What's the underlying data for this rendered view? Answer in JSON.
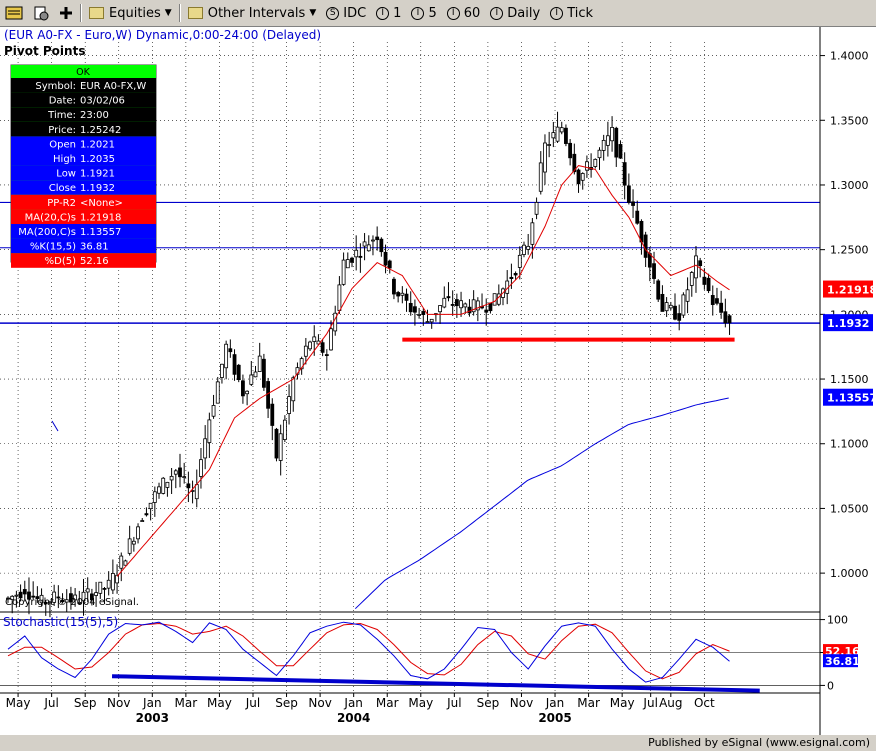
{
  "toolbar": {
    "items": [
      {
        "label": "Equities",
        "icon": "folder-icon",
        "dropdown": true
      },
      {
        "label": "Other Intervals",
        "icon": "folder-icon",
        "dropdown": true
      },
      {
        "label": "IDC",
        "icon": "S"
      },
      {
        "label": "1",
        "icon": "I"
      },
      {
        "label": "5",
        "icon": "I"
      },
      {
        "label": "60",
        "icon": "I"
      },
      {
        "label": "Daily",
        "icon": "I"
      },
      {
        "label": "Tick",
        "icon": "I"
      }
    ]
  },
  "chart": {
    "title": "(EUR A0-FX - Euro,W) Dynamic,0:00-24:00 (Delayed)",
    "study_label": "Pivot Points",
    "copyright": "Copyright © 2004 eSignal.",
    "stochastic_label": "Stochastic(15(5),5)"
  },
  "data_box": {
    "ok_label": "OK",
    "rows": [
      {
        "label": "Symbol:",
        "value": "EUR A0-FX,W",
        "bg": "#000000"
      },
      {
        "label": "Date:",
        "value": "03/02/06",
        "bg": "#000000"
      },
      {
        "label": "Time:",
        "value": "23:00",
        "bg": "#000000"
      },
      {
        "label": "Price:",
        "value": "1.25242",
        "bg": "#000000"
      },
      {
        "label": "Open",
        "value": "1.2021",
        "bg": "#0000ff"
      },
      {
        "label": "High",
        "value": "1.2035",
        "bg": "#0000ff"
      },
      {
        "label": "Low",
        "value": "1.1921",
        "bg": "#0000ff"
      },
      {
        "label": "Close",
        "value": "1.1932",
        "bg": "#0000ff"
      },
      {
        "label": "PP-R2",
        "value": "<None>",
        "bg": "#ff0000"
      },
      {
        "label": "MA(20,C)s",
        "value": "1.21918",
        "bg": "#ff0000"
      },
      {
        "label": "MA(200,C)s",
        "value": "1.13557",
        "bg": "#0000ff"
      },
      {
        "label": "%K(15,5)",
        "value": "36.81",
        "bg": "#0000ff"
      },
      {
        "label": "%D(5)",
        "value": "52.16",
        "bg": "#ff0000"
      }
    ]
  },
  "price_labels": {
    "ma20": {
      "text": "1.21918",
      "color": "#ff0000",
      "value": 1.21918
    },
    "close": {
      "text": "1.1932",
      "color": "#0000ff",
      "value": 1.1932
    },
    "ma200": {
      "text": "1.13557",
      "color": "#0000ff",
      "value": 1.13557
    }
  },
  "stoch_labels": {
    "d": {
      "text": "52.16",
      "color": "#ff0000",
      "value": 52.16
    },
    "k": {
      "text": "36.81",
      "color": "#0000ff",
      "value": 36.81
    }
  },
  "status_bar": {
    "text": "Published by eSignal (www.esignal.com)"
  },
  "chart_data": {
    "type": "candlestick",
    "y_ticks": [
      "1.4000",
      "1.3500",
      "1.3000",
      "1.2500",
      "1.2000",
      "1.1500",
      "1.1000",
      "1.0500",
      "1.0000"
    ],
    "ylim": [
      0.9715,
      1.4105
    ],
    "stoch_ticks": [
      "100",
      "50",
      "0"
    ],
    "stoch_ylim": [
      -10,
      110
    ],
    "x_months": [
      {
        "label": "May",
        "t": 0.6
      },
      {
        "label": "Jul",
        "t": 2.6
      },
      {
        "label": "Sep",
        "t": 4.6
      },
      {
        "label": "Nov",
        "t": 6.6
      },
      {
        "label": "Jan",
        "t": 8.6
      },
      {
        "label": "Mar",
        "t": 10.6
      },
      {
        "label": "May",
        "t": 12.6
      },
      {
        "label": "Jul",
        "t": 14.6
      },
      {
        "label": "Sep",
        "t": 16.6
      },
      {
        "label": "Nov",
        "t": 18.6
      },
      {
        "label": "Jan",
        "t": 20.6
      },
      {
        "label": "Mar",
        "t": 22.6
      },
      {
        "label": "May",
        "t": 24.6
      },
      {
        "label": "Jul",
        "t": 26.6
      },
      {
        "label": "Sep",
        "t": 28.6
      },
      {
        "label": "Nov",
        "t": 30.6
      },
      {
        "label": "Jan",
        "t": 32.6
      },
      {
        "label": "Mar",
        "t": 34.6
      },
      {
        "label": "May",
        "t": 36.6
      },
      {
        "label": "Jul",
        "t": 38.3
      },
      {
        "label": "Aug",
        "t": 39.5
      },
      {
        "label": "Oct",
        "t": 41.5
      }
    ],
    "x_years": [
      {
        "label": "2003",
        "t": 8.6
      },
      {
        "label": "2004",
        "t": 20.6
      },
      {
        "label": "2005",
        "t": 32.6
      }
    ],
    "horizontal_lines": [
      {
        "value": 1.2865,
        "color": "#0000cc",
        "width": 1.2
      },
      {
        "value": 1.2515,
        "color": "#0000cc",
        "width": 1
      },
      {
        "value": 1.1932,
        "color": "#0000cc",
        "width": 1.5
      }
    ],
    "support_line": {
      "t0": 23.5,
      "t1": 43.3,
      "value": 1.1805,
      "color": "#ff0000"
    },
    "stoch_trendline": {
      "t0": 6.2,
      "v0": 14,
      "t1": 44.8,
      "v1": -8,
      "color": "#0000cc"
    },
    "price_anchors": [
      [
        0.0,
        0.98
      ],
      [
        1.0,
        0.988
      ],
      [
        2.0,
        0.977
      ],
      [
        3.0,
        0.982
      ],
      [
        4.0,
        0.979
      ],
      [
        5.0,
        0.985
      ],
      [
        6.0,
        0.99
      ],
      [
        7.0,
        1.015
      ],
      [
        8.0,
        1.045
      ],
      [
        9.0,
        1.065
      ],
      [
        10.0,
        1.08
      ],
      [
        11.0,
        1.058
      ],
      [
        12.0,
        1.12
      ],
      [
        13.0,
        1.175
      ],
      [
        14.0,
        1.14
      ],
      [
        15.0,
        1.165
      ],
      [
        16.0,
        1.09
      ],
      [
        17.0,
        1.15
      ],
      [
        18.0,
        1.18
      ],
      [
        19.0,
        1.17
      ],
      [
        20.0,
        1.24
      ],
      [
        21.0,
        1.25
      ],
      [
        22.0,
        1.262
      ],
      [
        23.0,
        1.22
      ],
      [
        24.0,
        1.205
      ],
      [
        25.0,
        1.195
      ],
      [
        26.0,
        1.21
      ],
      [
        27.0,
        1.207
      ],
      [
        28.0,
        1.205
      ],
      [
        29.0,
        1.21
      ],
      [
        30.0,
        1.23
      ],
      [
        31.0,
        1.255
      ],
      [
        32.0,
        1.33
      ],
      [
        33.0,
        1.345
      ],
      [
        34.0,
        1.305
      ],
      [
        35.0,
        1.32
      ],
      [
        36.0,
        1.34
      ],
      [
        37.0,
        1.29
      ],
      [
        38.0,
        1.25
      ],
      [
        39.0,
        1.205
      ],
      [
        40.0,
        1.2
      ],
      [
        41.0,
        1.24
      ],
      [
        42.0,
        1.21
      ],
      [
        43.0,
        1.193
      ]
    ],
    "ma20_anchors": [
      [
        6.5,
        0.9975
      ],
      [
        8.0,
        1.02
      ],
      [
        10.0,
        1.05
      ],
      [
        12.0,
        1.08
      ],
      [
        13.5,
        1.12
      ],
      [
        15.0,
        1.135
      ],
      [
        17.0,
        1.15
      ],
      [
        19.0,
        1.185
      ],
      [
        20.5,
        1.22
      ],
      [
        22.0,
        1.24
      ],
      [
        23.5,
        1.23
      ],
      [
        25.0,
        1.2
      ],
      [
        27.0,
        1.2
      ],
      [
        29.0,
        1.21
      ],
      [
        30.5,
        1.23
      ],
      [
        32.0,
        1.268
      ],
      [
        33.0,
        1.3
      ],
      [
        34.0,
        1.315
      ],
      [
        35.0,
        1.312
      ],
      [
        36.0,
        1.292
      ],
      [
        37.0,
        1.275
      ],
      [
        38.0,
        1.25
      ],
      [
        39.5,
        1.23
      ],
      [
        41.0,
        1.238
      ],
      [
        42.3,
        1.225
      ],
      [
        43.0,
        1.219
      ]
    ],
    "ma200_anchors": [
      [
        20.7,
        0.9725
      ],
      [
        22.5,
        0.995
      ],
      [
        24.5,
        1.01
      ],
      [
        27.0,
        1.032
      ],
      [
        29.0,
        1.052
      ],
      [
        31.0,
        1.072
      ],
      [
        33.0,
        1.083
      ],
      [
        35.0,
        1.1
      ],
      [
        37.0,
        1.115
      ],
      [
        39.0,
        1.122
      ],
      [
        41.0,
        1.13
      ],
      [
        43.0,
        1.1355
      ]
    ],
    "k_anchors": [
      [
        0.0,
        55
      ],
      [
        1.0,
        75
      ],
      [
        2.0,
        42
      ],
      [
        3.0,
        25
      ],
      [
        4.0,
        12
      ],
      [
        5.0,
        40
      ],
      [
        6.0,
        78
      ],
      [
        7.0,
        94
      ],
      [
        8.0,
        92
      ],
      [
        9.0,
        96
      ],
      [
        10.0,
        82
      ],
      [
        11.0,
        65
      ],
      [
        12.0,
        95
      ],
      [
        13.0,
        85
      ],
      [
        14.0,
        55
      ],
      [
        15.0,
        35
      ],
      [
        16.0,
        15
      ],
      [
        17.0,
        45
      ],
      [
        18.0,
        80
      ],
      [
        19.0,
        90
      ],
      [
        20.0,
        96
      ],
      [
        21.0,
        92
      ],
      [
        22.0,
        70
      ],
      [
        23.0,
        45
      ],
      [
        24.0,
        15
      ],
      [
        25.0,
        10
      ],
      [
        26.0,
        25
      ],
      [
        27.0,
        55
      ],
      [
        28.0,
        88
      ],
      [
        29.0,
        85
      ],
      [
        30.0,
        50
      ],
      [
        31.0,
        25
      ],
      [
        32.0,
        60
      ],
      [
        33.0,
        90
      ],
      [
        34.0,
        95
      ],
      [
        35.0,
        90
      ],
      [
        36.0,
        55
      ],
      [
        37.0,
        25
      ],
      [
        38.0,
        5
      ],
      [
        39.0,
        12
      ],
      [
        40.0,
        40
      ],
      [
        41.0,
        70
      ],
      [
        42.0,
        58
      ],
      [
        43.0,
        36.81
      ]
    ],
    "d_anchors": [
      [
        0.0,
        45
      ],
      [
        1.0,
        58
      ],
      [
        2.0,
        58
      ],
      [
        3.0,
        42
      ],
      [
        4.0,
        25
      ],
      [
        5.0,
        28
      ],
      [
        6.0,
        50
      ],
      [
        7.0,
        78
      ],
      [
        8.0,
        92
      ],
      [
        9.0,
        94
      ],
      [
        10.0,
        90
      ],
      [
        11.0,
        78
      ],
      [
        12.0,
        82
      ],
      [
        13.0,
        90
      ],
      [
        14.0,
        75
      ],
      [
        15.0,
        52
      ],
      [
        16.0,
        30
      ],
      [
        17.0,
        30
      ],
      [
        18.0,
        55
      ],
      [
        19.0,
        80
      ],
      [
        20.0,
        92
      ],
      [
        21.0,
        94
      ],
      [
        22.0,
        85
      ],
      [
        23.0,
        62
      ],
      [
        24.0,
        35
      ],
      [
        25.0,
        18
      ],
      [
        26.0,
        16
      ],
      [
        27.0,
        32
      ],
      [
        28.0,
        62
      ],
      [
        29.0,
        82
      ],
      [
        30.0,
        75
      ],
      [
        31.0,
        48
      ],
      [
        32.0,
        40
      ],
      [
        33.0,
        68
      ],
      [
        34.0,
        90
      ],
      [
        35.0,
        93
      ],
      [
        36.0,
        80
      ],
      [
        37.0,
        50
      ],
      [
        38.0,
        22
      ],
      [
        39.0,
        10
      ],
      [
        40.0,
        20
      ],
      [
        41.0,
        48
      ],
      [
        42.0,
        62
      ],
      [
        43.0,
        52.16
      ]
    ]
  }
}
